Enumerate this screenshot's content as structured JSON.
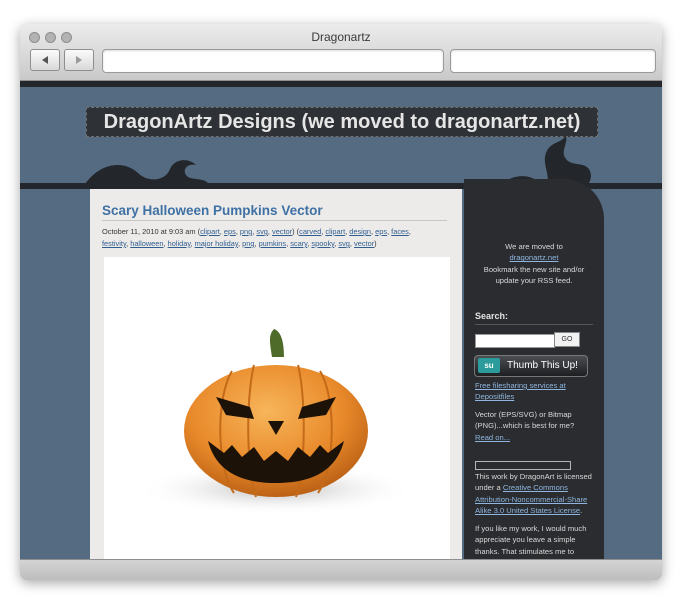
{
  "window": {
    "title": "Dragonartz",
    "url": "",
    "search": ""
  },
  "site": {
    "title": "DragonArtz Designs (we moved to dragonartz.net)"
  },
  "post": {
    "title": "Scary Halloween Pumpkins Vector",
    "date": "October 11, 2010 at 9:03 am",
    "tags_a": [
      "clipart",
      "eps",
      "png",
      "svg",
      "vector"
    ],
    "tags_b_line1": [
      "carved",
      "clipart",
      "design",
      "eps",
      "faces"
    ],
    "tags_b_line2": [
      "festivity",
      "halloween",
      "holiday",
      "major holiday",
      "png",
      "pumkins",
      "scary",
      "spooky",
      "svg",
      "vector"
    ]
  },
  "sidebar": {
    "moved_line1": "We are moved to",
    "moved_link": "dragonartz.net",
    "moved_line2": "Bookmark the new site and/or",
    "moved_line3": "update your RSS feed.",
    "search_heading": "Search:",
    "search_button": "GO",
    "stumble_icon": "su",
    "stumble_label": "Thumb This Up!",
    "filesharing_line1": "Free filesharing services at",
    "filesharing_line2": "Depositfiles",
    "vector_line1": "Vector (EPS/SVG) or Bitmap",
    "vector_line2": "(PNG)...which is best for me?",
    "read_on": "Read on...",
    "license_line1": "This work by DragonArt is licensed",
    "license_under": "under a",
    "license_link1": "Creative Commons",
    "license_link2": "Attribution-Noncommercial-Share",
    "license_link3": "Alike 3.0 United States License",
    "appreciate_line1": "If you like my work, I would much",
    "appreciate_line2": "appreciate you leave a simple",
    "appreciate_line3": "thanks. That stimulates me to"
  },
  "colors": {
    "page_bg": "#556b82",
    "post_title": "#3f71a4",
    "pumpkin": "#e8892a"
  },
  "icons": {
    "back": "back-arrow-icon",
    "forward": "forward-arrow-icon"
  }
}
